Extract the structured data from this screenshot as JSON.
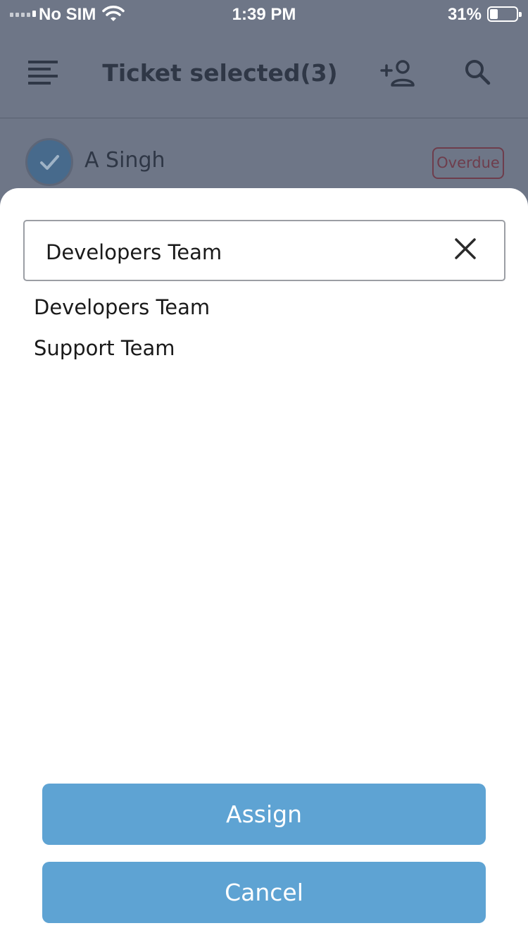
{
  "status_bar": {
    "carrier": "No SIM",
    "time": "1:39 PM",
    "battery_percent": "31%",
    "battery_level": 0.31
  },
  "header": {
    "title": "Ticket selected(3)",
    "menu_icon": "menu-icon",
    "add_user_icon": "add-user-icon",
    "search_icon": "search-icon"
  },
  "ticket": {
    "name": "A Singh",
    "badge": "Overdue",
    "selected": true
  },
  "sheet": {
    "search_value": "Developers Team",
    "options": [
      {
        "label": "Developers Team"
      },
      {
        "label": "Support Team"
      }
    ],
    "assign_label": "Assign",
    "cancel_label": "Cancel"
  },
  "colors": {
    "overlay": "#6e7687",
    "primary_button": "#5ea3d3",
    "badge": "#6e3d4c",
    "header_text": "#2f3746"
  }
}
